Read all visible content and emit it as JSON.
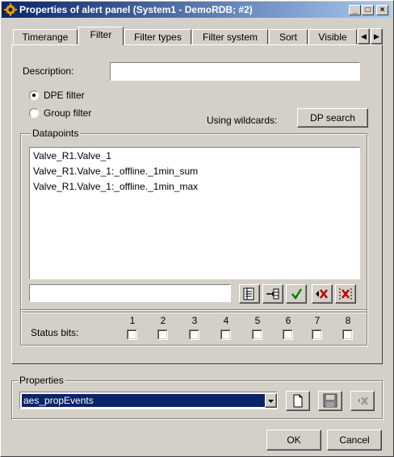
{
  "window": {
    "title": "Properties of alert panel (System1 - DemoRDB; #2)",
    "controls": {
      "minimize": "_",
      "maximize": "□",
      "close": "×"
    }
  },
  "tabs": [
    {
      "label": "Timerange",
      "active": false
    },
    {
      "label": "Filter",
      "active": true
    },
    {
      "label": "Filter types",
      "active": false
    },
    {
      "label": "Filter system",
      "active": false
    },
    {
      "label": "Sort",
      "active": false
    },
    {
      "label": "Visible",
      "active": false
    }
  ],
  "tab_scroll": {
    "left": "◀",
    "right": "▶"
  },
  "filter": {
    "description_label": "Description:",
    "description_value": "",
    "dpe_filter_label": "DPE filter",
    "dpe_filter_selected": true,
    "group_filter_label": "Group filter",
    "group_filter_selected": false,
    "wildcards_label": "Using wildcards:",
    "dp_search_label": "DP search"
  },
  "datapoints": {
    "label": "Datapoints",
    "items": [
      "Valve_R1.Valve_1",
      "Valve_R1.Valve_1:_offline._1min_sum",
      "Valve_R1.Valve_1:_offline._1min_max"
    ],
    "entry_value": "",
    "toolbar_icons": [
      "select-dp-icon",
      "insert-icon",
      "checkmark-icon",
      "delete-icon",
      "delete-all-icon"
    ]
  },
  "status_bits": {
    "label": "Status bits:",
    "bits": [
      "1",
      "2",
      "3",
      "4",
      "5",
      "6",
      "7",
      "8"
    ]
  },
  "properties": {
    "label": "Properties",
    "selected": "aes_propEvents",
    "icons": [
      "new-document-icon",
      "save-icon",
      "delete-icon"
    ]
  },
  "footer": {
    "ok_label": "OK",
    "cancel_label": "Cancel"
  },
  "colors": {
    "title_start": "#0a246a",
    "title_end": "#a6caf0",
    "face": "#d4d0c8",
    "selection": "#0a246a",
    "check_green": "#008000",
    "delete_red": "#c00000"
  }
}
